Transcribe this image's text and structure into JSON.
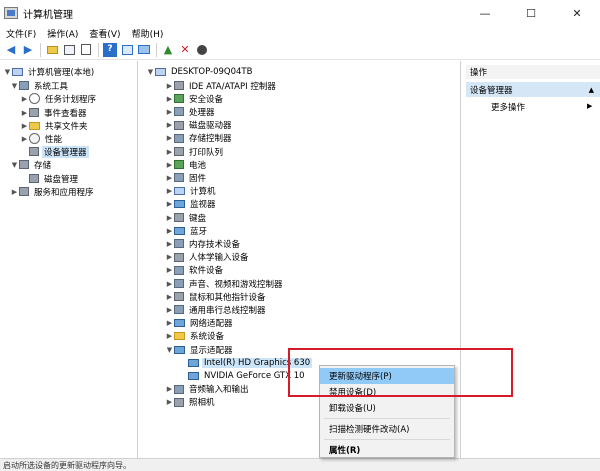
{
  "window": {
    "title": "计算机管理",
    "controls": {
      "minimize": "—",
      "maximize": "☐",
      "close": "✕"
    }
  },
  "menubar": [
    "文件(F)",
    "操作(A)",
    "查看(V)",
    "帮助(H)"
  ],
  "toolbar": {
    "icons": [
      "back-icon",
      "forward-icon",
      "up-folder-icon",
      "show-tree-icon",
      "properties-icon",
      "help-icon",
      "action-pane-icon",
      "monitor-icon",
      "update-driver-icon",
      "uninstall-icon",
      "disable-icon"
    ]
  },
  "left_tree": {
    "root": "计算机管理(本地)",
    "system_tools": "系统工具",
    "task_scheduler": "任务计划程序",
    "event_viewer": "事件查看器",
    "shared_folders": "共享文件夹",
    "performance": "性能",
    "device_manager": "设备管理器",
    "storage": "存储",
    "disk_management": "磁盘管理",
    "services_apps": "服务和应用程序"
  },
  "device_tree": {
    "root": "DESKTOP-09Q04TB",
    "categories": [
      "IDE ATA/ATAPI 控制器",
      "安全设备",
      "处理器",
      "磁盘驱动器",
      "存储控制器",
      "打印队列",
      "电池",
      "固件",
      "计算机",
      "监视器",
      "键盘",
      "蓝牙",
      "内存技术设备",
      "人体学输入设备",
      "软件设备",
      "声音、视频和游戏控制器",
      "鼠标和其他指针设备",
      "通用串行总线控制器",
      "网络适配器",
      "系统设备",
      "显示适配器"
    ],
    "display_children": [
      "Intel(R) HD Graphics 630",
      "NVIDIA GeForce GTX 10"
    ],
    "after": [
      "音频输入和输出",
      "照相机"
    ]
  },
  "actions": {
    "header": "操作",
    "section": "设备管理器",
    "section_arrow": "▲",
    "more": "更多操作",
    "more_arrow": "▶"
  },
  "context_menu": {
    "update_driver": "更新驱动程序(P)",
    "disable_device": "禁用设备(D)",
    "uninstall_device": "卸载设备(U)",
    "scan_hardware": "扫描检测硬件改动(A)",
    "properties": "属性(R)"
  },
  "statusbar": {
    "text": "启动所选设备的更新驱动程序向导。"
  },
  "colors": {
    "highlight_border": "#d21c27",
    "selection": "#cce4f7",
    "menu_hover": "#91c9f7"
  }
}
